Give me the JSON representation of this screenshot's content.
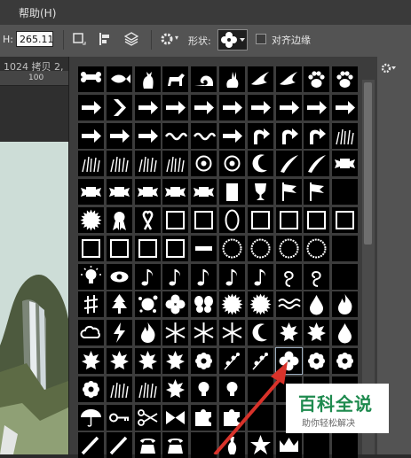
{
  "menubar": {
    "items": [
      "帮助(H)"
    ]
  },
  "options": {
    "h_label": "H:",
    "h_value": "265.11",
    "shape_label": "形状:",
    "align_label": "对齐边缘"
  },
  "tab": {
    "title": "1024 拷贝 2,"
  },
  "ruler": {
    "mark": "100"
  },
  "shape_grid": {
    "cols": 10,
    "cells": [
      "bone",
      "fish",
      "cat",
      "dog",
      "snail",
      "rabbit",
      "bird-feather",
      "dove",
      "paw",
      "paw-print",
      "arrow-thin",
      "chevron-right",
      "arrow-right",
      "arrow-simple",
      "triangle-arrow",
      "arrow-outline",
      "arrow-feather",
      "arrow-block",
      "arrow-block-2",
      "arrow-sketch",
      "arrow-fat",
      "pentagon-arrow",
      "arrow-bold",
      "squiggle",
      "squiggle-2",
      "wave-arrow",
      "u-turn-arrow",
      "curved-arrow",
      "turn-arrow",
      "grass-tuft",
      "grass-1",
      "grass-2",
      "grass-3",
      "grass-4",
      "ornament",
      "ornament-2",
      "moon-wave",
      "horn",
      "horn-2",
      "banner-scroll",
      "banner",
      "banner-curved",
      "banner-2",
      "banner-3",
      "banner-4",
      "sign-frame",
      "trophy",
      "flag",
      "flag-2",
      "empty-cell",
      "seal",
      "ribbon-award",
      "awareness-ribbon",
      "film-frame",
      "frame-ornate",
      "frame-oval",
      "frame-rect",
      "frame-ornate-2",
      "frame-scallop",
      "frame-empty",
      "stamp-frame",
      "frame-square",
      "frame-bordered",
      "frame-grunge",
      "frame-line",
      "frame-circle",
      "frame-circle-2",
      "frame-circle-3",
      "frame-circle-4",
      "empty-cell-2",
      "light-bulb-on",
      "eye",
      "eighth-note",
      "quarter-note",
      "eighth-note-2",
      "beamed-notes",
      "sixteenth-note",
      "bass-clef",
      "treble-clef",
      "empty-cell-3",
      "sharp-sign",
      "tree",
      "splat",
      "clover",
      "butterfly",
      "sun-burst",
      "starburst",
      "waves",
      "raindrop",
      "fire",
      "cloud",
      "lightning",
      "flame",
      "snowflake",
      "snowflake-2",
      "snowflake-3",
      "crescent-moon",
      "leaf",
      "maple-leaf",
      "teardrop",
      "leaf-2",
      "maple",
      "leaf-3",
      "leaf-4",
      "flower-5",
      "flower-branch",
      "flower-branch-2",
      "flower-4-selected",
      "flower-8",
      "flower-scallop",
      "flower-daisy",
      "grass-patch",
      "grass-blades",
      "leaf-sprout",
      "light-bulb",
      "light-bulb-2",
      "empty-cell-4",
      "empty-cell-5",
      "empty-cell-6",
      "empty-cell-7",
      "umbrella",
      "key",
      "scissors",
      "bow",
      "puzzle",
      "puzzle-2",
      "empty-cell-8",
      "empty-cell-9",
      "empty-cell-10",
      "empty-cell-11",
      "pencil",
      "pencil-2",
      "phone",
      "telephone",
      "empty-cell-12",
      "bowling-pin",
      "sheriff-star",
      "crown",
      "empty-cell-13",
      "empty-cell-14"
    ]
  },
  "watermark": {
    "title": "百科全说",
    "subtitle": "助你轻松解决"
  }
}
